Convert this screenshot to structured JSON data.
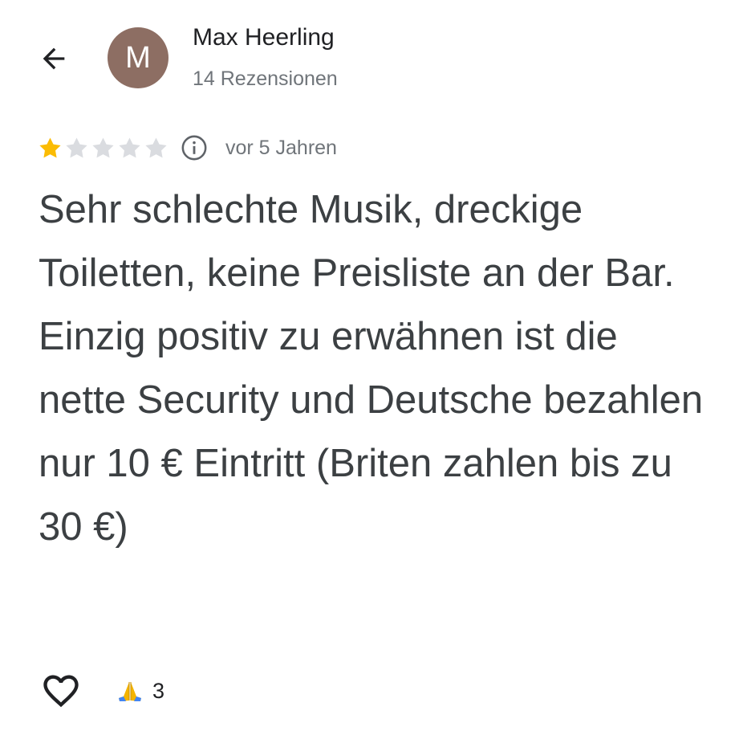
{
  "author": {
    "avatar_initial": "M",
    "avatar_color": "#8d6e63",
    "name": "Max Heerling",
    "review_count": "14 Rezensionen"
  },
  "review": {
    "rating": 1,
    "max_rating": 5,
    "star_color_filled": "#fbbc04",
    "star_color_empty": "#dadce0",
    "date": "vor 5 Jahren",
    "text": "Sehr schlechte Musik, dreckige Toiletten, keine Preisliste an der Bar. Einzig positiv zu erwähnen ist die nette Security und Deutsche bezahlen nur 10 € Eintritt (Briten zahlen bis zu 30 €)"
  },
  "icons": {
    "back": "arrow-back-icon",
    "info": "info-icon",
    "like": "heart-icon",
    "reaction": "folded-hands-icon"
  },
  "reactions": {
    "count": "3"
  }
}
